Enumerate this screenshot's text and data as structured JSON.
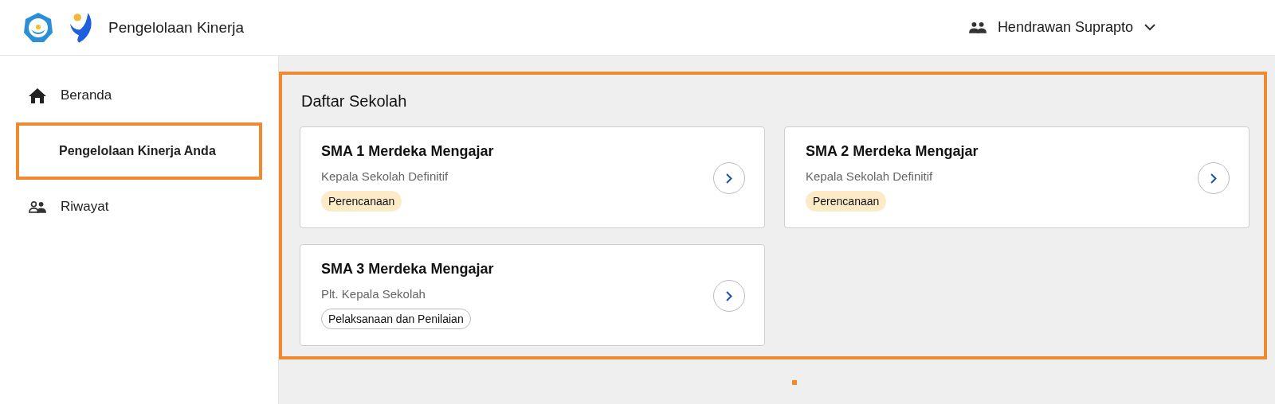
{
  "header": {
    "app_title": "Pengelolaan Kinerja",
    "user": {
      "name": "Hendrawan Suprapto"
    }
  },
  "sidebar": {
    "items": [
      {
        "label": "Beranda",
        "kind": "home",
        "highlighted": false
      },
      {
        "label": "Pengelolaan Kinerja Anda",
        "kind": "plain",
        "highlighted": true
      },
      {
        "label": "Riwayat",
        "kind": "people",
        "highlighted": false
      }
    ]
  },
  "main": {
    "title": "Daftar Sekolah",
    "highlighted": true,
    "schools": [
      {
        "name": "SMA 1 Merdeka Mengajar",
        "role": "Kepala Sekolah Definitif",
        "tag": {
          "label": "Perencanaan",
          "kind": "filled"
        }
      },
      {
        "name": "SMA 2 Merdeka Mengajar",
        "role": "Kepala Sekolah Definitif",
        "tag": {
          "label": "Perencanaan",
          "kind": "filled"
        }
      },
      {
        "name": "SMA 3 Merdeka Mengajar",
        "role": "Plt. Kepala Sekolah",
        "tag": {
          "label": "Pelaksanaan dan Penilaian",
          "kind": "outlined"
        }
      }
    ]
  }
}
